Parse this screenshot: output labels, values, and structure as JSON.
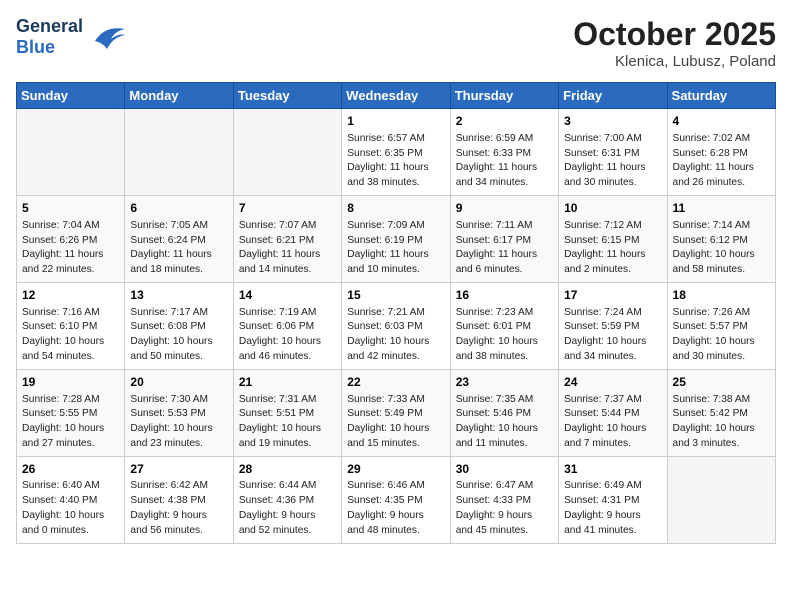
{
  "header": {
    "logo_general": "General",
    "logo_blue": "Blue",
    "title": "October 2025",
    "subtitle": "Klenica, Lubusz, Poland"
  },
  "days_of_week": [
    "Sunday",
    "Monday",
    "Tuesday",
    "Wednesday",
    "Thursday",
    "Friday",
    "Saturday"
  ],
  "weeks": [
    [
      {
        "num": "",
        "info": ""
      },
      {
        "num": "",
        "info": ""
      },
      {
        "num": "",
        "info": ""
      },
      {
        "num": "1",
        "info": "Sunrise: 6:57 AM\nSunset: 6:35 PM\nDaylight: 11 hours\nand 38 minutes."
      },
      {
        "num": "2",
        "info": "Sunrise: 6:59 AM\nSunset: 6:33 PM\nDaylight: 11 hours\nand 34 minutes."
      },
      {
        "num": "3",
        "info": "Sunrise: 7:00 AM\nSunset: 6:31 PM\nDaylight: 11 hours\nand 30 minutes."
      },
      {
        "num": "4",
        "info": "Sunrise: 7:02 AM\nSunset: 6:28 PM\nDaylight: 11 hours\nand 26 minutes."
      }
    ],
    [
      {
        "num": "5",
        "info": "Sunrise: 7:04 AM\nSunset: 6:26 PM\nDaylight: 11 hours\nand 22 minutes."
      },
      {
        "num": "6",
        "info": "Sunrise: 7:05 AM\nSunset: 6:24 PM\nDaylight: 11 hours\nand 18 minutes."
      },
      {
        "num": "7",
        "info": "Sunrise: 7:07 AM\nSunset: 6:21 PM\nDaylight: 11 hours\nand 14 minutes."
      },
      {
        "num": "8",
        "info": "Sunrise: 7:09 AM\nSunset: 6:19 PM\nDaylight: 11 hours\nand 10 minutes."
      },
      {
        "num": "9",
        "info": "Sunrise: 7:11 AM\nSunset: 6:17 PM\nDaylight: 11 hours\nand 6 minutes."
      },
      {
        "num": "10",
        "info": "Sunrise: 7:12 AM\nSunset: 6:15 PM\nDaylight: 11 hours\nand 2 minutes."
      },
      {
        "num": "11",
        "info": "Sunrise: 7:14 AM\nSunset: 6:12 PM\nDaylight: 10 hours\nand 58 minutes."
      }
    ],
    [
      {
        "num": "12",
        "info": "Sunrise: 7:16 AM\nSunset: 6:10 PM\nDaylight: 10 hours\nand 54 minutes."
      },
      {
        "num": "13",
        "info": "Sunrise: 7:17 AM\nSunset: 6:08 PM\nDaylight: 10 hours\nand 50 minutes."
      },
      {
        "num": "14",
        "info": "Sunrise: 7:19 AM\nSunset: 6:06 PM\nDaylight: 10 hours\nand 46 minutes."
      },
      {
        "num": "15",
        "info": "Sunrise: 7:21 AM\nSunset: 6:03 PM\nDaylight: 10 hours\nand 42 minutes."
      },
      {
        "num": "16",
        "info": "Sunrise: 7:23 AM\nSunset: 6:01 PM\nDaylight: 10 hours\nand 38 minutes."
      },
      {
        "num": "17",
        "info": "Sunrise: 7:24 AM\nSunset: 5:59 PM\nDaylight: 10 hours\nand 34 minutes."
      },
      {
        "num": "18",
        "info": "Sunrise: 7:26 AM\nSunset: 5:57 PM\nDaylight: 10 hours\nand 30 minutes."
      }
    ],
    [
      {
        "num": "19",
        "info": "Sunrise: 7:28 AM\nSunset: 5:55 PM\nDaylight: 10 hours\nand 27 minutes."
      },
      {
        "num": "20",
        "info": "Sunrise: 7:30 AM\nSunset: 5:53 PM\nDaylight: 10 hours\nand 23 minutes."
      },
      {
        "num": "21",
        "info": "Sunrise: 7:31 AM\nSunset: 5:51 PM\nDaylight: 10 hours\nand 19 minutes."
      },
      {
        "num": "22",
        "info": "Sunrise: 7:33 AM\nSunset: 5:49 PM\nDaylight: 10 hours\nand 15 minutes."
      },
      {
        "num": "23",
        "info": "Sunrise: 7:35 AM\nSunset: 5:46 PM\nDaylight: 10 hours\nand 11 minutes."
      },
      {
        "num": "24",
        "info": "Sunrise: 7:37 AM\nSunset: 5:44 PM\nDaylight: 10 hours\nand 7 minutes."
      },
      {
        "num": "25",
        "info": "Sunrise: 7:38 AM\nSunset: 5:42 PM\nDaylight: 10 hours\nand 3 minutes."
      }
    ],
    [
      {
        "num": "26",
        "info": "Sunrise: 6:40 AM\nSunset: 4:40 PM\nDaylight: 10 hours\nand 0 minutes."
      },
      {
        "num": "27",
        "info": "Sunrise: 6:42 AM\nSunset: 4:38 PM\nDaylight: 9 hours\nand 56 minutes."
      },
      {
        "num": "28",
        "info": "Sunrise: 6:44 AM\nSunset: 4:36 PM\nDaylight: 9 hours\nand 52 minutes."
      },
      {
        "num": "29",
        "info": "Sunrise: 6:46 AM\nSunset: 4:35 PM\nDaylight: 9 hours\nand 48 minutes."
      },
      {
        "num": "30",
        "info": "Sunrise: 6:47 AM\nSunset: 4:33 PM\nDaylight: 9 hours\nand 45 minutes."
      },
      {
        "num": "31",
        "info": "Sunrise: 6:49 AM\nSunset: 4:31 PM\nDaylight: 9 hours\nand 41 minutes."
      },
      {
        "num": "",
        "info": ""
      }
    ]
  ]
}
